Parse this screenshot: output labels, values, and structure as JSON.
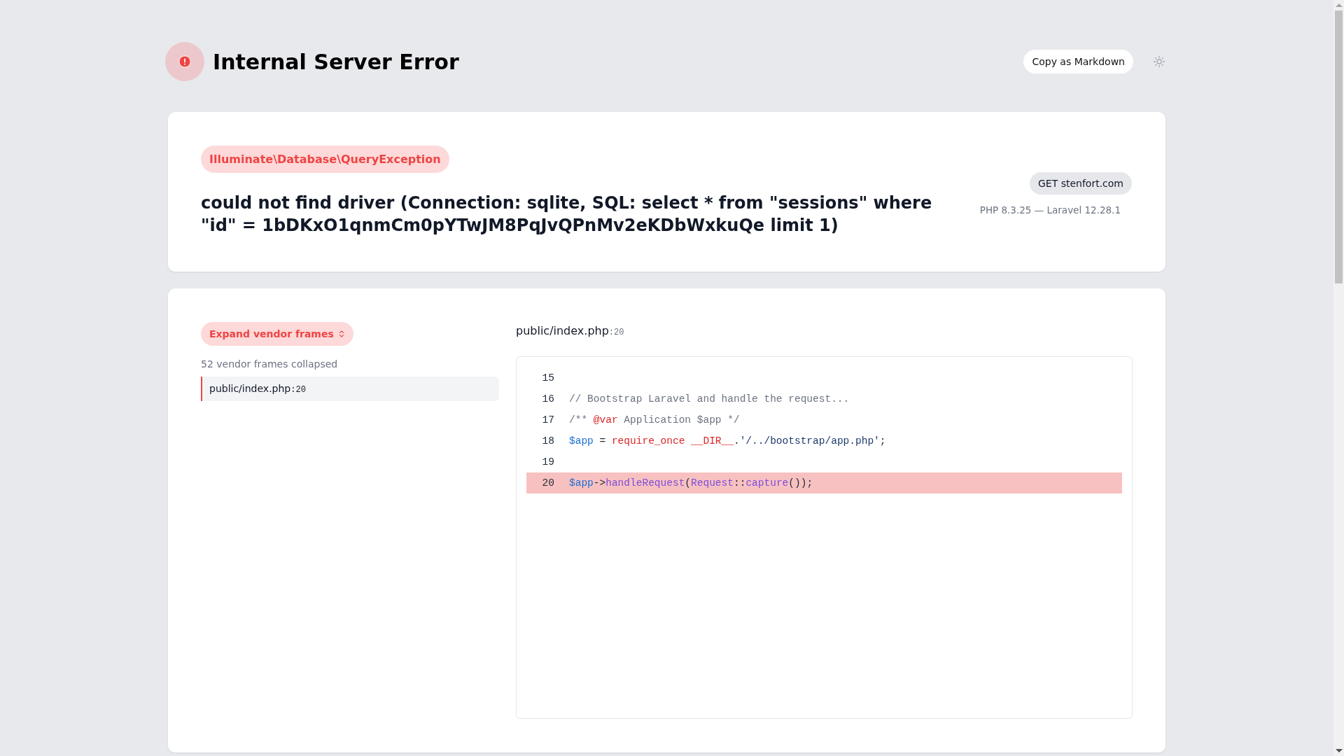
{
  "header": {
    "title": "Internal Server Error",
    "copy_button": "Copy as Markdown"
  },
  "error": {
    "exception": "Illuminate\\Database\\QueryException",
    "message": "could not find driver (Connection: sqlite, SQL: select * from \"sessions\" where \"id\" = 1bDKxO1qnmCm0pYTwJM8PqJvQPnMv2eKDbWxkuQe limit 1)",
    "request": "GET stenfort.com",
    "versions": "PHP 8.3.25 — Laravel 12.28.1"
  },
  "frames": {
    "expand_button": "Expand vendor frames",
    "collapsed_note": "52 vendor frames collapsed",
    "items": [
      {
        "file": "public/index.php",
        "line": ":20",
        "selected": true
      }
    ]
  },
  "code": {
    "file": "public/index.php",
    "line": ":20",
    "lines": [
      {
        "number": "15",
        "highlighted": false
      },
      {
        "number": "16",
        "highlighted": false,
        "tokens": [
          {
            "kind": "comment",
            "text": "// Bootstrap Laravel and handle the request..."
          }
        ]
      },
      {
        "number": "17",
        "highlighted": false,
        "tokens": [
          {
            "kind": "comment",
            "text": "/** "
          },
          {
            "kind": "keyword",
            "text": "@var"
          },
          {
            "kind": "comment",
            "text": " Application $app */"
          }
        ]
      },
      {
        "number": "18",
        "highlighted": false,
        "tokens": [
          {
            "kind": "variable",
            "text": "$app"
          },
          {
            "kind": "plain",
            "text": " = "
          },
          {
            "kind": "keyword",
            "text": "require_once __DIR__"
          },
          {
            "kind": "plain",
            "text": "."
          },
          {
            "kind": "string",
            "text": "'/../bootstrap/app.php'"
          },
          {
            "kind": "plain",
            "text": ";"
          }
        ]
      },
      {
        "number": "19",
        "highlighted": false
      },
      {
        "number": "20",
        "highlighted": true,
        "tokens": [
          {
            "kind": "variable",
            "text": "$app"
          },
          {
            "kind": "plain",
            "text": "->"
          },
          {
            "kind": "function",
            "text": "handleRequest"
          },
          {
            "kind": "plain",
            "text": "("
          },
          {
            "kind": "function",
            "text": "Request"
          },
          {
            "kind": "plain",
            "text": "::"
          },
          {
            "kind": "function",
            "text": "capture"
          },
          {
            "kind": "plain",
            "text": "());"
          }
        ]
      }
    ]
  }
}
